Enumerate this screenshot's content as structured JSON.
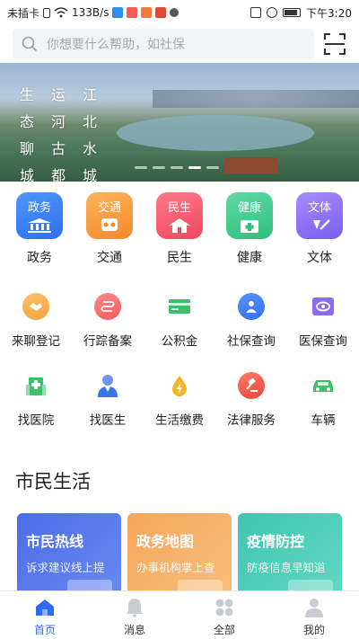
{
  "status_bar": {
    "carrier": "未插卡",
    "speed": "133B/s",
    "time": "下午3:20"
  },
  "search": {
    "placeholder": "你想要什么帮助，如社保"
  },
  "banner": {
    "poem_columns": [
      [
        "生",
        "态",
        "聊",
        "城"
      ],
      [
        "运",
        "河",
        "古",
        "都"
      ],
      [
        "江",
        "北",
        "水",
        "城"
      ]
    ],
    "slide_count": 5,
    "active_slide": 3
  },
  "categories": [
    {
      "tile_label": "政务",
      "name": "政务",
      "color": "#2f7cf6"
    },
    {
      "tile_label": "交通",
      "name": "交通",
      "color": "#f79a36"
    },
    {
      "tile_label": "民生",
      "name": "民生",
      "color": "#f5576c"
    },
    {
      "tile_label": "健康",
      "name": "健康",
      "color": "#3cc48b"
    },
    {
      "tile_label": "文体",
      "name": "文体",
      "color": "#8b6cf2"
    }
  ],
  "services": [
    {
      "name": "来聊登记",
      "icon": "handshake-icon",
      "color": "#f3a73a"
    },
    {
      "name": "行踪备案",
      "icon": "route-icon",
      "color": "#f05a5a"
    },
    {
      "name": "公积金",
      "icon": "card-icon",
      "color": "#3bbf6b"
    },
    {
      "name": "社保查询",
      "icon": "social-security-icon",
      "color": "#3b73e8"
    },
    {
      "name": "医保查询",
      "icon": "medical-card-icon",
      "color": "#8a6cf0"
    },
    {
      "name": "找医院",
      "icon": "hospital-icon",
      "color": "#3bbf6b"
    },
    {
      "name": "找医生",
      "icon": "doctor-icon",
      "color": "#3b73e8"
    },
    {
      "name": "生活缴费",
      "icon": "bolt-icon",
      "color": "#f3b52b"
    },
    {
      "name": "法律服务",
      "icon": "gavel-icon",
      "color": "#f05a5a"
    },
    {
      "name": "车辆",
      "icon": "car-icon",
      "color": "#3bbf6b"
    }
  ],
  "section": {
    "title": "市民生活"
  },
  "cards": [
    {
      "title": "市民热线",
      "subtitle": "诉求建议线上提"
    },
    {
      "title": "政务地图",
      "subtitle": "办事机构掌上查"
    },
    {
      "title": "疫情防控",
      "subtitle": "防疫信息早知道"
    }
  ],
  "bottom_nav": [
    {
      "label": "首页",
      "icon": "home-icon",
      "active": true
    },
    {
      "label": "消息",
      "icon": "bell-icon",
      "active": false
    },
    {
      "label": "全部",
      "icon": "grid-icon",
      "active": false
    },
    {
      "label": "我的",
      "icon": "user-icon",
      "active": false
    }
  ],
  "colors": {
    "accent": "#2f6bf0"
  }
}
